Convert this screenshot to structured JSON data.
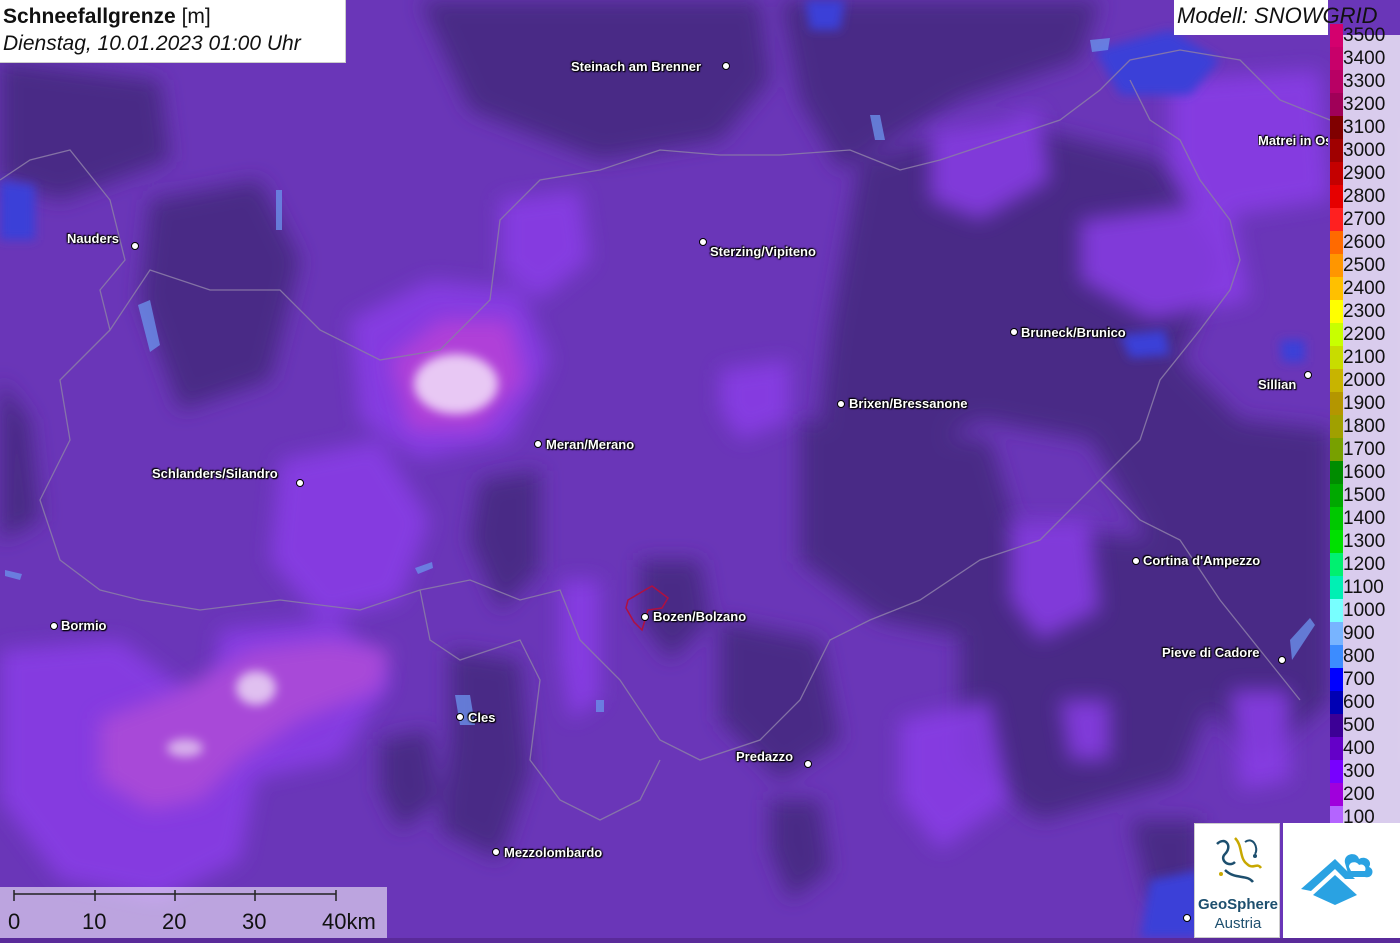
{
  "title": {
    "bold": "Schneefallgrenze",
    "unit": "[m]",
    "datetime": "Dienstag, 10.01.2023 01:00 Uhr"
  },
  "model": "Modell: SNOWGRID",
  "legend": [
    {
      "label": "3500",
      "color": "#d4006e"
    },
    {
      "label": "3400",
      "color": "#c8006a"
    },
    {
      "label": "3300",
      "color": "#b80064"
    },
    {
      "label": "3200",
      "color": "#a00058"
    },
    {
      "label": "3100",
      "color": "#800000"
    },
    {
      "label": "3000",
      "color": "#a00000"
    },
    {
      "label": "2900",
      "color": "#c40000"
    },
    {
      "label": "2800",
      "color": "#e60000"
    },
    {
      "label": "2700",
      "color": "#ff2020"
    },
    {
      "label": "2600",
      "color": "#ff6a00"
    },
    {
      "label": "2500",
      "color": "#ff9600"
    },
    {
      "label": "2400",
      "color": "#ffc000"
    },
    {
      "label": "2300",
      "color": "#ffff00"
    },
    {
      "label": "2200",
      "color": "#c8ff00"
    },
    {
      "label": "2100",
      "color": "#c8dc00"
    },
    {
      "label": "2000",
      "color": "#c8b400"
    },
    {
      "label": "1900",
      "color": "#b49600"
    },
    {
      "label": "1800",
      "color": "#a0a000"
    },
    {
      "label": "1700",
      "color": "#78a000"
    },
    {
      "label": "1600",
      "color": "#008c00"
    },
    {
      "label": "1500",
      "color": "#00a800"
    },
    {
      "label": "1400",
      "color": "#00c800"
    },
    {
      "label": "1300",
      "color": "#00e000"
    },
    {
      "label": "1200",
      "color": "#00f070"
    },
    {
      "label": "1100",
      "color": "#00f0b4"
    },
    {
      "label": "1000",
      "color": "#78ffff"
    },
    {
      "label": "900",
      "color": "#78b4ff"
    },
    {
      "label": "800",
      "color": "#3c8cff"
    },
    {
      "label": "700",
      "color": "#0000ff"
    },
    {
      "label": "600",
      "color": "#0000b4"
    },
    {
      "label": "500",
      "color": "#3c0096"
    },
    {
      "label": "400",
      "color": "#6400c8"
    },
    {
      "label": "300",
      "color": "#7800ff"
    },
    {
      "label": "200",
      "color": "#a000dc"
    },
    {
      "label": "100",
      "color": "#b464ff"
    }
  ],
  "scale": {
    "labels": [
      "0",
      "10",
      "20",
      "30",
      "40km"
    ]
  },
  "cities": [
    {
      "name": "Steinach am Brenner"
    },
    {
      "name": "Nauders"
    },
    {
      "name": "Sterzing/Vipiteno"
    },
    {
      "name": "Matrei in Osttirol"
    },
    {
      "name": "Bruneck/Brunico"
    },
    {
      "name": "Sillian"
    },
    {
      "name": "Brixen/Bressanone"
    },
    {
      "name": "Meran/Merano"
    },
    {
      "name": "Schlanders/Silandro"
    },
    {
      "name": "Cortina d'Ampezzo"
    },
    {
      "name": "Bormio"
    },
    {
      "name": "Bozen/Bolzano"
    },
    {
      "name": "Pieve di Cadore"
    },
    {
      "name": "Cles"
    },
    {
      "name": "Predazzo"
    },
    {
      "name": "Mezzolombardo"
    }
  ],
  "logos": {
    "geosphere_line1": "GeoSphere",
    "geosphere_line2": "Austria"
  }
}
